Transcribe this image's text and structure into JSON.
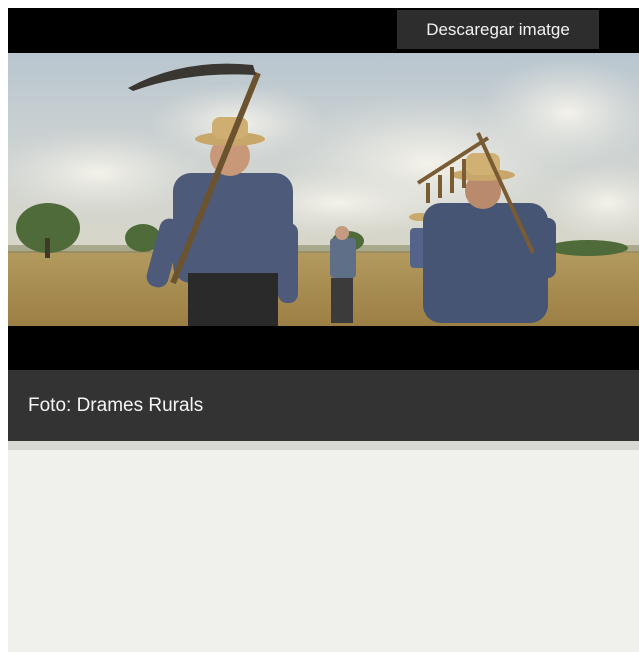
{
  "toolbar": {
    "download_label": "Descaregar imatge"
  },
  "caption": {
    "text": "Foto: Drames Rurals"
  },
  "colors": {
    "frame": "#000000",
    "caption_bg": "#333333",
    "button_bg": "#2d2d2d",
    "panel_bg": "#f0f0ec"
  }
}
